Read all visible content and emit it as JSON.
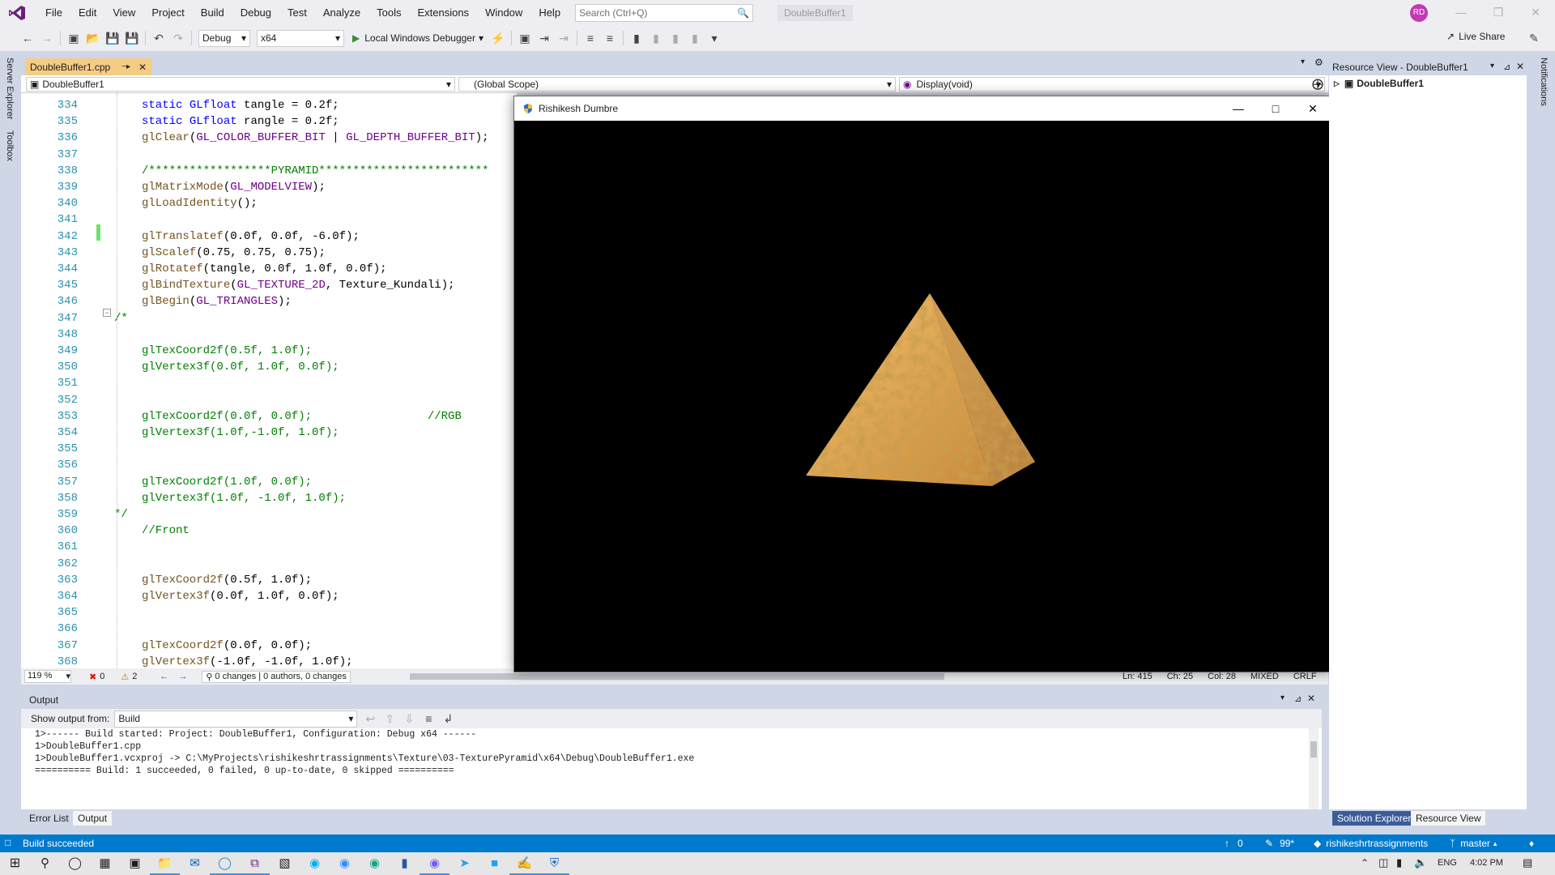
{
  "menubar": {
    "items": [
      "File",
      "Edit",
      "View",
      "Project",
      "Build",
      "Debug",
      "Test",
      "Analyze",
      "Tools",
      "Extensions",
      "Window",
      "Help"
    ],
    "search_placeholder": "Search (Ctrl+Q)",
    "solution_name": "DoubleBuffer1",
    "avatar_initials": "RD"
  },
  "toolbar": {
    "config": "Debug",
    "platform": "x64",
    "debugger": "Local Windows Debugger",
    "live_share": "Live Share"
  },
  "side_tabs": {
    "left": [
      "Server Explorer",
      "Toolbox"
    ],
    "right": [
      "Notifications"
    ]
  },
  "editor": {
    "tab_label": "DoubleBuffer1.cpp",
    "nav_project": "DoubleBuffer1",
    "nav_scope": "(Global Scope)",
    "nav_member": "Display(void)",
    "lines": [
      {
        "n": "334",
        "code": "static GLfloat tangle = 0.2f;"
      },
      {
        "n": "335",
        "code": "static GLfloat rangle = 0.2f;"
      },
      {
        "n": "336",
        "code": "glClear(GL_COLOR_BUFFER_BIT | GL_DEPTH_BUFFER_BIT);"
      },
      {
        "n": "337",
        "code": ""
      },
      {
        "n": "338",
        "code": "/******************PYRAMID*************************"
      },
      {
        "n": "339",
        "code": "glMatrixMode(GL_MODELVIEW);"
      },
      {
        "n": "340",
        "code": "glLoadIdentity();"
      },
      {
        "n": "341",
        "code": ""
      },
      {
        "n": "342",
        "code": "glTranslatef(0.0f, 0.0f, -6.0f);"
      },
      {
        "n": "343",
        "code": "glScalef(0.75, 0.75, 0.75);"
      },
      {
        "n": "344",
        "code": "glRotatef(tangle, 0.0f, 1.0f, 0.0f);"
      },
      {
        "n": "345",
        "code": "glBindTexture(GL_TEXTURE_2D, Texture_Kundali);"
      },
      {
        "n": "346",
        "code": "glBegin(GL_TRIANGLES);"
      },
      {
        "n": "347",
        "code": "/*"
      },
      {
        "n": "348",
        "code": ""
      },
      {
        "n": "349",
        "code": "glTexCoord2f(0.5f, 1.0f);"
      },
      {
        "n": "350",
        "code": "glVertex3f(0.0f, 1.0f, 0.0f);"
      },
      {
        "n": "351",
        "code": ""
      },
      {
        "n": "352",
        "code": ""
      },
      {
        "n": "353",
        "code": "glTexCoord2f(0.0f, 0.0f);                 //RGB"
      },
      {
        "n": "354",
        "code": "glVertex3f(1.0f,-1.0f, 1.0f);"
      },
      {
        "n": "355",
        "code": ""
      },
      {
        "n": "356",
        "code": ""
      },
      {
        "n": "357",
        "code": "glTexCoord2f(1.0f, 0.0f);"
      },
      {
        "n": "358",
        "code": "glVertex3f(1.0f, -1.0f, 1.0f);"
      },
      {
        "n": "359",
        "code": "*/"
      },
      {
        "n": "360",
        "code": "//Front"
      },
      {
        "n": "361",
        "code": ""
      },
      {
        "n": "362",
        "code": ""
      },
      {
        "n": "363",
        "code": "glTexCoord2f(0.5f, 1.0f);"
      },
      {
        "n": "364",
        "code": "glVertex3f(0.0f, 1.0f, 0.0f);"
      },
      {
        "n": "365",
        "code": ""
      },
      {
        "n": "366",
        "code": ""
      },
      {
        "n": "367",
        "code": "glTexCoord2f(0.0f, 0.0f);"
      },
      {
        "n": "368",
        "code": "glVertex3f(-1.0f, -1.0f, 1.0f);"
      }
    ],
    "status": {
      "zoom": "119 %",
      "errors": "0",
      "warnings": "2",
      "changes": "0 changes | 0 authors, 0 changes",
      "ln": "Ln: 415",
      "ch": "Ch: 25",
      "col": "Col: 28",
      "mode": "MIXED",
      "eol": "CRLF"
    }
  },
  "app_window": {
    "title": "Rishikesh Dumbre"
  },
  "output": {
    "header": "Output",
    "show_from_label": "Show output from:",
    "source": "Build",
    "lines": [
      "1>------ Build started: Project: DoubleBuffer1, Configuration: Debug x64 ------",
      "1>DoubleBuffer1.cpp",
      "1>DoubleBuffer1.vcxproj -> C:\\MyProjects\\rishikeshrtrassignments\\Texture\\03-TexturePyramid\\x64\\Debug\\DoubleBuffer1.exe",
      "========== Build: 1 succeeded, 0 failed, 0 up-to-date, 0 skipped =========="
    ],
    "tabs": [
      "Error List",
      "Output"
    ]
  },
  "resource_view": {
    "title": "Resource View - DoubleBuffer1",
    "root": "DoubleBuffer1",
    "tabs": [
      "Solution Explorer",
      "Resource View"
    ]
  },
  "statusbar": {
    "message": "Build succeeded",
    "up_count": "0",
    "pencil_count": "99*",
    "repo": "rishikeshrtrassignments",
    "branch": "master"
  },
  "taskbar": {
    "lang": "ENG",
    "time": "4:02 PM"
  },
  "colors": {
    "accent": "#007acc",
    "active_tab": "#f5cc84",
    "vs_purple": "#68217a"
  }
}
